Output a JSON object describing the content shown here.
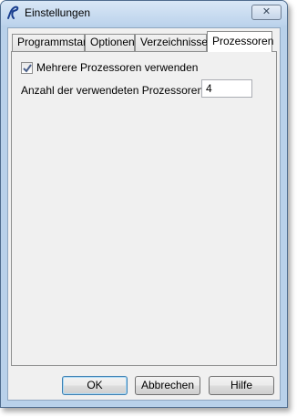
{
  "window": {
    "title": "Einstellungen",
    "close_symbol": "✕"
  },
  "tabs": [
    {
      "label": "Programmstart",
      "active": false
    },
    {
      "label": "Optionen",
      "active": false
    },
    {
      "label": "Verzeichnisse",
      "active": false
    },
    {
      "label": "Prozessoren",
      "active": true
    }
  ],
  "panel": {
    "multi_processor": {
      "label": "Mehrere Prozessoren verwenden",
      "checked": true
    },
    "processor_count": {
      "label": "Anzahl der verwendeten Prozessoren:",
      "value": "4"
    }
  },
  "buttons": {
    "ok": "OK",
    "cancel": "Abbrechen",
    "help": "Hilfe"
  },
  "icons": {
    "app": "app-logo-icon",
    "check": "checkmark-icon",
    "close": "close-icon"
  },
  "colors": {
    "frame": "#b9d1ea",
    "client": "#f0f0f0",
    "default_button_border": "#3c7fb1"
  }
}
